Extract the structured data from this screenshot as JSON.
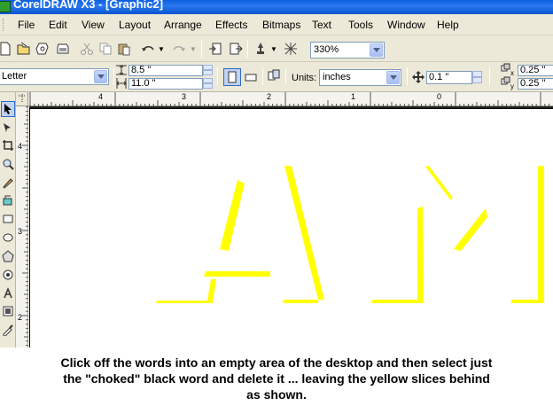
{
  "window": {
    "title": "CorelDRAW X3 - [Graphic2]"
  },
  "menu": {
    "items": [
      "File",
      "Edit",
      "View",
      "Layout",
      "Arrange",
      "Effects",
      "Bitmaps",
      "Text",
      "Tools",
      "Window",
      "Help"
    ]
  },
  "standard_toolbar": {
    "zoom_value": "330%",
    "icons": [
      "new-icon",
      "open-icon",
      "save-icon",
      "print-icon",
      "cut-icon",
      "copy-icon",
      "paste-icon",
      "undo-icon",
      "redo-icon",
      "import-icon",
      "export-icon",
      "application-launcher-icon",
      "welcome-screen-icon"
    ]
  },
  "property_bar": {
    "paper_type": "Letter",
    "paper_width": "8.5 \"",
    "paper_height": "11.0 \"",
    "units_label": "Units:",
    "units_value": "inches",
    "nudge_value": "0.1 \"",
    "duplicate_x": "0.25 \"",
    "duplicate_y": "0.25 \""
  },
  "ruler": {
    "horizontal_labels": [
      "4",
      "3",
      "2",
      "1",
      "0"
    ],
    "vertical_labels": [
      "4",
      "3",
      "2"
    ]
  },
  "canvas": {
    "shape_color": "#ffff00"
  },
  "caption": {
    "lines": [
      "Click off the words into an empty area of the desktop and then select just",
      "the \"choked\" black word and delete it ... leaving the yellow slices behind",
      "as shown."
    ]
  }
}
